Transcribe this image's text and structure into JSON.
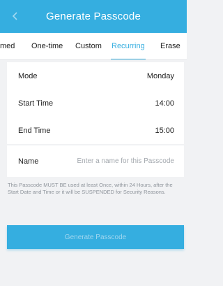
{
  "header": {
    "title": "Generate Passcode"
  },
  "tabs": [
    {
      "label": "med"
    },
    {
      "label": "One-time"
    },
    {
      "label": "Custom"
    },
    {
      "label": "Recurring"
    },
    {
      "label": "Erase"
    }
  ],
  "active_tab": "Recurring",
  "settings": {
    "mode": {
      "label": "Mode",
      "value": "Monday"
    },
    "start_time": {
      "label": "Start Time",
      "value": "14:00"
    },
    "end_time": {
      "label": "End Time",
      "value": "15:00"
    }
  },
  "name_field": {
    "label": "Name",
    "placeholder": "Enter a name for this Passcode",
    "value": ""
  },
  "notice": "This Passcode MUST BE used at least Once, within 24 Hours, after the Start Date and Time or it will be SUSPENDED for Security Reasons.",
  "generate_button": {
    "label": "Generate Passcode"
  },
  "colors": {
    "accent": "#35aee0",
    "background": "#f1f2f4"
  }
}
